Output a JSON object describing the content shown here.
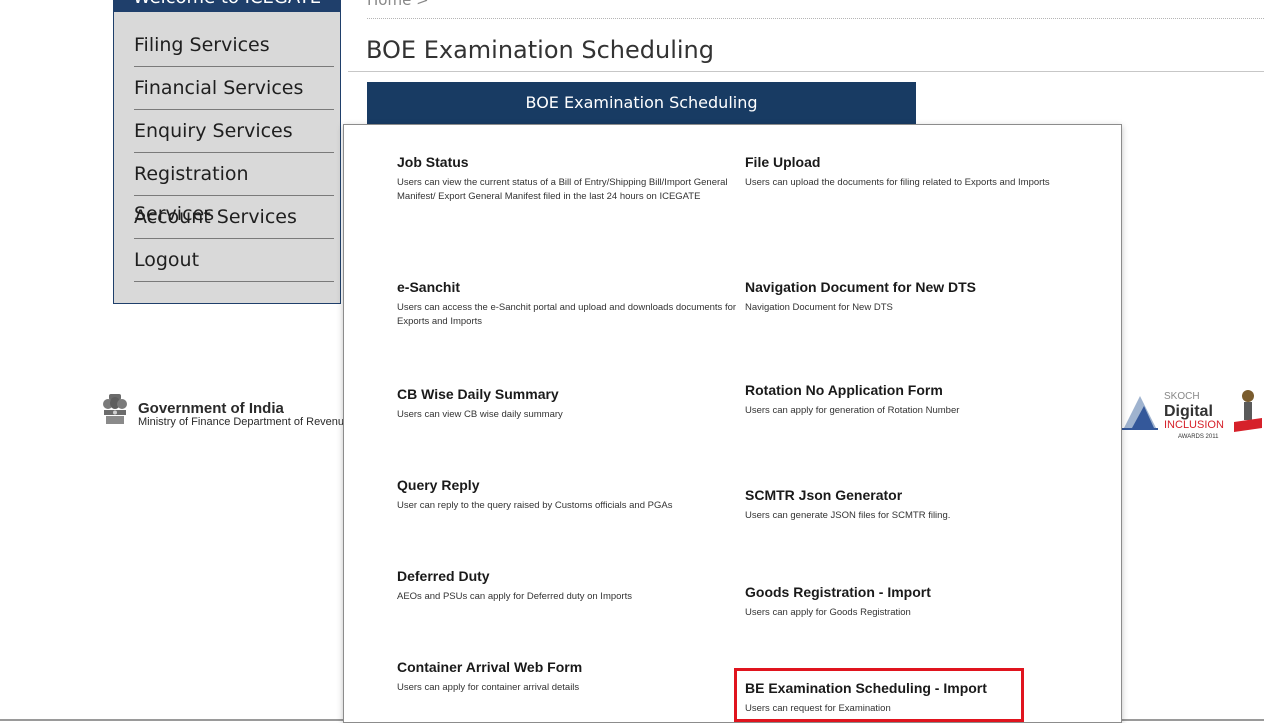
{
  "sidebar": {
    "welcome": "Welcome to ICEGATE",
    "items": [
      {
        "label": "Filing Services"
      },
      {
        "label": "Financial Services"
      },
      {
        "label": "Enquiry Services"
      },
      {
        "label": "Registration Services"
      },
      {
        "label": "Account Services"
      },
      {
        "label": "Logout"
      }
    ]
  },
  "breadcrumb": "Home >",
  "page": {
    "title": "BOE Examination Scheduling",
    "button_label": "BOE Examination Scheduling"
  },
  "footer": {
    "gov_title": "Government of India",
    "gov_subtitle": "Ministry of Finance Department of Revenue",
    "award_text": "SKOCH Digital INCLUSION AWARDS 2011"
  },
  "menu": {
    "left": [
      {
        "title": "Job Status",
        "desc": "Users can view the current status of a Bill of Entry/Shipping Bill/Import General Manifest/ Export General Manifest filed in the last 24 hours on ICEGATE"
      },
      {
        "title": "e-Sanchit",
        "desc": "Users can access the e-Sanchit portal and upload and downloads documents for Exports and Imports"
      },
      {
        "title": "CB Wise Daily Summary",
        "desc": "Users can view CB wise daily summary"
      },
      {
        "title": "Query Reply",
        "desc": "User can reply to the query raised by Customs officials and PGAs"
      },
      {
        "title": "Deferred Duty",
        "desc": "AEOs and PSUs can apply for Deferred duty on Imports"
      },
      {
        "title": "Container Arrival Web Form",
        "desc": "Users can apply for container arrival details"
      }
    ],
    "right": [
      {
        "title": "File Upload",
        "desc": "Users can upload the documents for filing related to Exports and Imports"
      },
      {
        "title": "Navigation Document for New DTS",
        "desc": "Navigation Document for New DTS"
      },
      {
        "title": "Rotation No Application Form",
        "desc": "Users can apply for generation of Rotation Number"
      },
      {
        "title": "SCMTR Json Generator",
        "desc": "Users can generate JSON files for SCMTR filing."
      },
      {
        "title": "Goods Registration - Import",
        "desc": "Users can apply for Goods Registration"
      },
      {
        "title": "BE Examination Scheduling - Import",
        "desc": "Users can request for Examination"
      }
    ]
  },
  "colors": {
    "nav_blue": "#183b63",
    "highlight_red": "#e0141e",
    "sidebar_bg": "#d9d9d9"
  }
}
